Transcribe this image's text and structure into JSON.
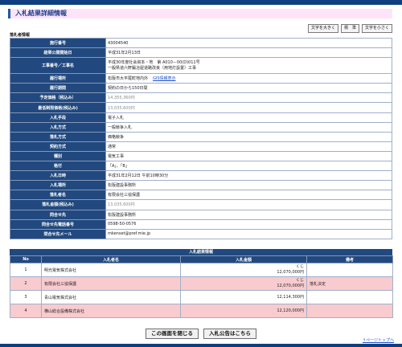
{
  "page": {
    "title": "入札結果詳細情報",
    "section_label": "落札者情報",
    "font_buttons": [
      "文字を大きく",
      "標　準",
      "文字を小さく"
    ]
  },
  "info_rows": [
    {
      "label": "施行番号",
      "value": "43004540"
    },
    {
      "label": "結果公開開始日",
      "value": "平成31年2月13日"
    },
    {
      "label": "工事番号／工事名",
      "line1": "平成30年度社会資本・地　第 A010－00(D)011号",
      "line2": "一般県道六軒鍛冶屋道路改良（用地灯設置）工事",
      "tall": true
    },
    {
      "label": "履行場所",
      "value": "松阪市大平尾町地内外",
      "link": "GIS情報表示"
    },
    {
      "label": "履行期間",
      "value": "契約の日から150日間"
    },
    {
      "label": "予定価格（税込み）",
      "value": "14,355,360円",
      "gray": true
    },
    {
      "label": "最低制限価格(税込み)",
      "value": "13,035,600円",
      "gray": true
    },
    {
      "label": "入札手段",
      "value": "電子入札"
    },
    {
      "label": "入札方式",
      "value": "一般競争入札"
    },
    {
      "label": "落札方式",
      "value": "価格競争"
    },
    {
      "label": "契約方式",
      "value": "通常"
    },
    {
      "label": "種別",
      "value": "電気工事"
    },
    {
      "label": "格付",
      "value": "「A」、「B」"
    },
    {
      "label": "入札日時",
      "value": "平成31年2月12日 午前10時30分"
    },
    {
      "label": "入札場所",
      "value": "松阪建設事務所"
    },
    {
      "label": "落札者名",
      "value": "有限会社三協保護"
    },
    {
      "label": "落札金額(税込み)",
      "value": "13,035,600円",
      "gray": true
    },
    {
      "label": "問合せ先",
      "value": "松阪建設事務所"
    },
    {
      "label": "問合せ先電話番号",
      "value": "0598-50-0576"
    },
    {
      "label": "問合せ先メール",
      "value": "mkenset@pref.mie.jp"
    }
  ],
  "results": {
    "caption": "入札結果情報",
    "headers": [
      "No",
      "入札者名",
      "入札金額",
      "備考"
    ],
    "rows": [
      {
        "no": "1",
        "name": "明光電気株式会社",
        "mark": "くじ",
        "amount": "12,070,000円",
        "note": "",
        "highlight": false
      },
      {
        "no": "2",
        "name": "有限会社三協保護",
        "mark": "くじ",
        "amount": "12,070,000円",
        "note": "落札決定",
        "highlight": true
      },
      {
        "no": "3",
        "name": "青山電気株式会社",
        "mark": "",
        "amount": "12,114,300円",
        "note": "",
        "highlight": false
      },
      {
        "no": "4",
        "name": "横山総合設備株式会社",
        "mark": "",
        "amount": "12,120,000円",
        "note": "",
        "highlight": true
      }
    ]
  },
  "footer": {
    "close_label": "この画面を閉じる",
    "notice_label": "入札公告はこちら",
    "pagetop_label": "ページトップへ"
  }
}
